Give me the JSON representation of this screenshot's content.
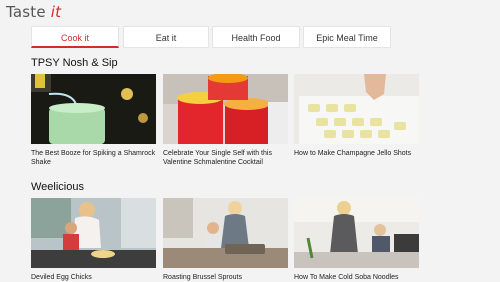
{
  "app": {
    "logo_prefix": "Taste ",
    "logo_accent": "it"
  },
  "tabs": [
    {
      "label": "Cook it",
      "active": true
    },
    {
      "label": "Eat it",
      "active": false
    },
    {
      "label": "Health Food",
      "active": false
    },
    {
      "label": "Epic Meal Time",
      "active": false
    }
  ],
  "sections": [
    {
      "title": "TPSY Nosh & Sip",
      "items": [
        {
          "caption": "The Best Booze for Spiking a Shamrock Shake"
        },
        {
          "caption": "Celebrate Your Single Self with this Valentine Schmalentine Cocktail"
        },
        {
          "caption": "How to Make Champagne Jello Shots"
        }
      ]
    },
    {
      "title": "Weelicious",
      "items": [
        {
          "caption": "Deviled Egg Chicks"
        },
        {
          "caption": "Roasting Brussel Sprouts"
        },
        {
          "caption": "How To Make Cold Soba Noodles"
        }
      ]
    }
  ],
  "colors": {
    "accent": "#d42b2b",
    "background": "#f3f3f3"
  }
}
